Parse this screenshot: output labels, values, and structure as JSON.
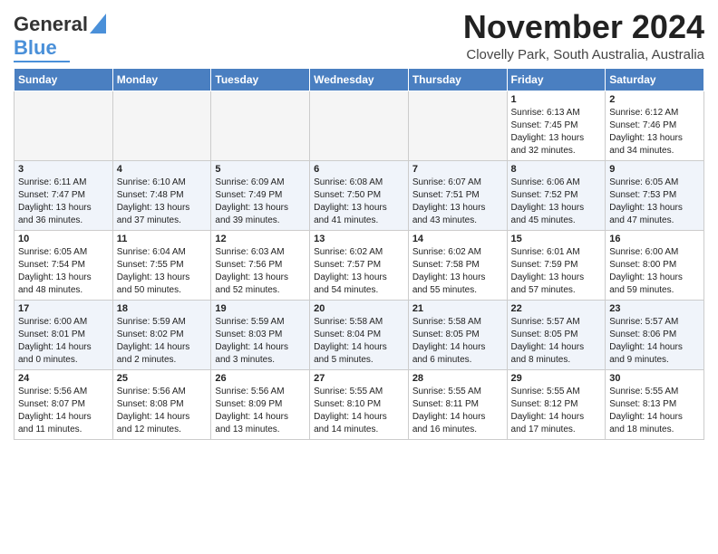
{
  "header": {
    "logo_line1": "General",
    "logo_line2": "Blue",
    "month": "November 2024",
    "location": "Clovelly Park, South Australia, Australia"
  },
  "days_of_week": [
    "Sunday",
    "Monday",
    "Tuesday",
    "Wednesday",
    "Thursday",
    "Friday",
    "Saturday"
  ],
  "weeks": [
    [
      {
        "day": "",
        "empty": true
      },
      {
        "day": "",
        "empty": true
      },
      {
        "day": "",
        "empty": true
      },
      {
        "day": "",
        "empty": true
      },
      {
        "day": "",
        "empty": true
      },
      {
        "day": "1",
        "sunrise": "6:13 AM",
        "sunset": "7:45 PM",
        "daylight": "13 hours and 32 minutes."
      },
      {
        "day": "2",
        "sunrise": "6:12 AM",
        "sunset": "7:46 PM",
        "daylight": "13 hours and 34 minutes."
      }
    ],
    [
      {
        "day": "3",
        "sunrise": "6:11 AM",
        "sunset": "7:47 PM",
        "daylight": "13 hours and 36 minutes."
      },
      {
        "day": "4",
        "sunrise": "6:10 AM",
        "sunset": "7:48 PM",
        "daylight": "13 hours and 37 minutes."
      },
      {
        "day": "5",
        "sunrise": "6:09 AM",
        "sunset": "7:49 PM",
        "daylight": "13 hours and 39 minutes."
      },
      {
        "day": "6",
        "sunrise": "6:08 AM",
        "sunset": "7:50 PM",
        "daylight": "13 hours and 41 minutes."
      },
      {
        "day": "7",
        "sunrise": "6:07 AM",
        "sunset": "7:51 PM",
        "daylight": "13 hours and 43 minutes."
      },
      {
        "day": "8",
        "sunrise": "6:06 AM",
        "sunset": "7:52 PM",
        "daylight": "13 hours and 45 minutes."
      },
      {
        "day": "9",
        "sunrise": "6:05 AM",
        "sunset": "7:53 PM",
        "daylight": "13 hours and 47 minutes."
      }
    ],
    [
      {
        "day": "10",
        "sunrise": "6:05 AM",
        "sunset": "7:54 PM",
        "daylight": "13 hours and 48 minutes."
      },
      {
        "day": "11",
        "sunrise": "6:04 AM",
        "sunset": "7:55 PM",
        "daylight": "13 hours and 50 minutes."
      },
      {
        "day": "12",
        "sunrise": "6:03 AM",
        "sunset": "7:56 PM",
        "daylight": "13 hours and 52 minutes."
      },
      {
        "day": "13",
        "sunrise": "6:02 AM",
        "sunset": "7:57 PM",
        "daylight": "13 hours and 54 minutes."
      },
      {
        "day": "14",
        "sunrise": "6:02 AM",
        "sunset": "7:58 PM",
        "daylight": "13 hours and 55 minutes."
      },
      {
        "day": "15",
        "sunrise": "6:01 AM",
        "sunset": "7:59 PM",
        "daylight": "13 hours and 57 minutes."
      },
      {
        "day": "16",
        "sunrise": "6:00 AM",
        "sunset": "8:00 PM",
        "daylight": "13 hours and 59 minutes."
      }
    ],
    [
      {
        "day": "17",
        "sunrise": "6:00 AM",
        "sunset": "8:01 PM",
        "daylight": "14 hours and 0 minutes."
      },
      {
        "day": "18",
        "sunrise": "5:59 AM",
        "sunset": "8:02 PM",
        "daylight": "14 hours and 2 minutes."
      },
      {
        "day": "19",
        "sunrise": "5:59 AM",
        "sunset": "8:03 PM",
        "daylight": "14 hours and 3 minutes."
      },
      {
        "day": "20",
        "sunrise": "5:58 AM",
        "sunset": "8:04 PM",
        "daylight": "14 hours and 5 minutes."
      },
      {
        "day": "21",
        "sunrise": "5:58 AM",
        "sunset": "8:05 PM",
        "daylight": "14 hours and 6 minutes."
      },
      {
        "day": "22",
        "sunrise": "5:57 AM",
        "sunset": "8:05 PM",
        "daylight": "14 hours and 8 minutes."
      },
      {
        "day": "23",
        "sunrise": "5:57 AM",
        "sunset": "8:06 PM",
        "daylight": "14 hours and 9 minutes."
      }
    ],
    [
      {
        "day": "24",
        "sunrise": "5:56 AM",
        "sunset": "8:07 PM",
        "daylight": "14 hours and 11 minutes."
      },
      {
        "day": "25",
        "sunrise": "5:56 AM",
        "sunset": "8:08 PM",
        "daylight": "14 hours and 12 minutes."
      },
      {
        "day": "26",
        "sunrise": "5:56 AM",
        "sunset": "8:09 PM",
        "daylight": "14 hours and 13 minutes."
      },
      {
        "day": "27",
        "sunrise": "5:55 AM",
        "sunset": "8:10 PM",
        "daylight": "14 hours and 14 minutes."
      },
      {
        "day": "28",
        "sunrise": "5:55 AM",
        "sunset": "8:11 PM",
        "daylight": "14 hours and 16 minutes."
      },
      {
        "day": "29",
        "sunrise": "5:55 AM",
        "sunset": "8:12 PM",
        "daylight": "14 hours and 17 minutes."
      },
      {
        "day": "30",
        "sunrise": "5:55 AM",
        "sunset": "8:13 PM",
        "daylight": "14 hours and 18 minutes."
      }
    ]
  ],
  "labels": {
    "sunrise": "Sunrise:",
    "sunset": "Sunset:",
    "daylight": "Daylight:"
  }
}
